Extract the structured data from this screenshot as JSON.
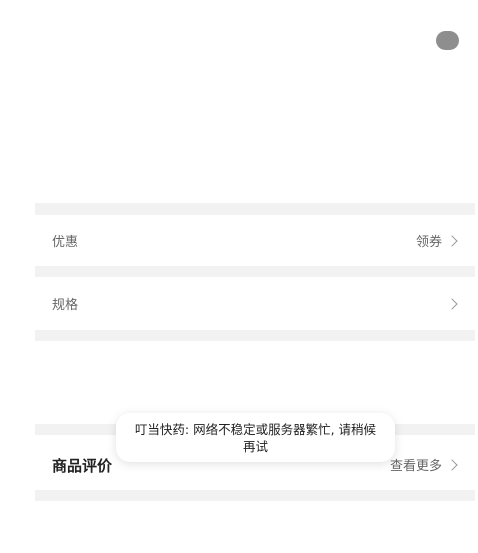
{
  "rows": {
    "coupon": {
      "label": "优惠",
      "action": "领券"
    },
    "spec": {
      "label": "规格"
    },
    "review": {
      "label": "商品评价",
      "action": "查看更多"
    }
  },
  "toast": {
    "message": "叮当快药: 网络不稳定或服务器繁忙, 请稍候再试"
  }
}
